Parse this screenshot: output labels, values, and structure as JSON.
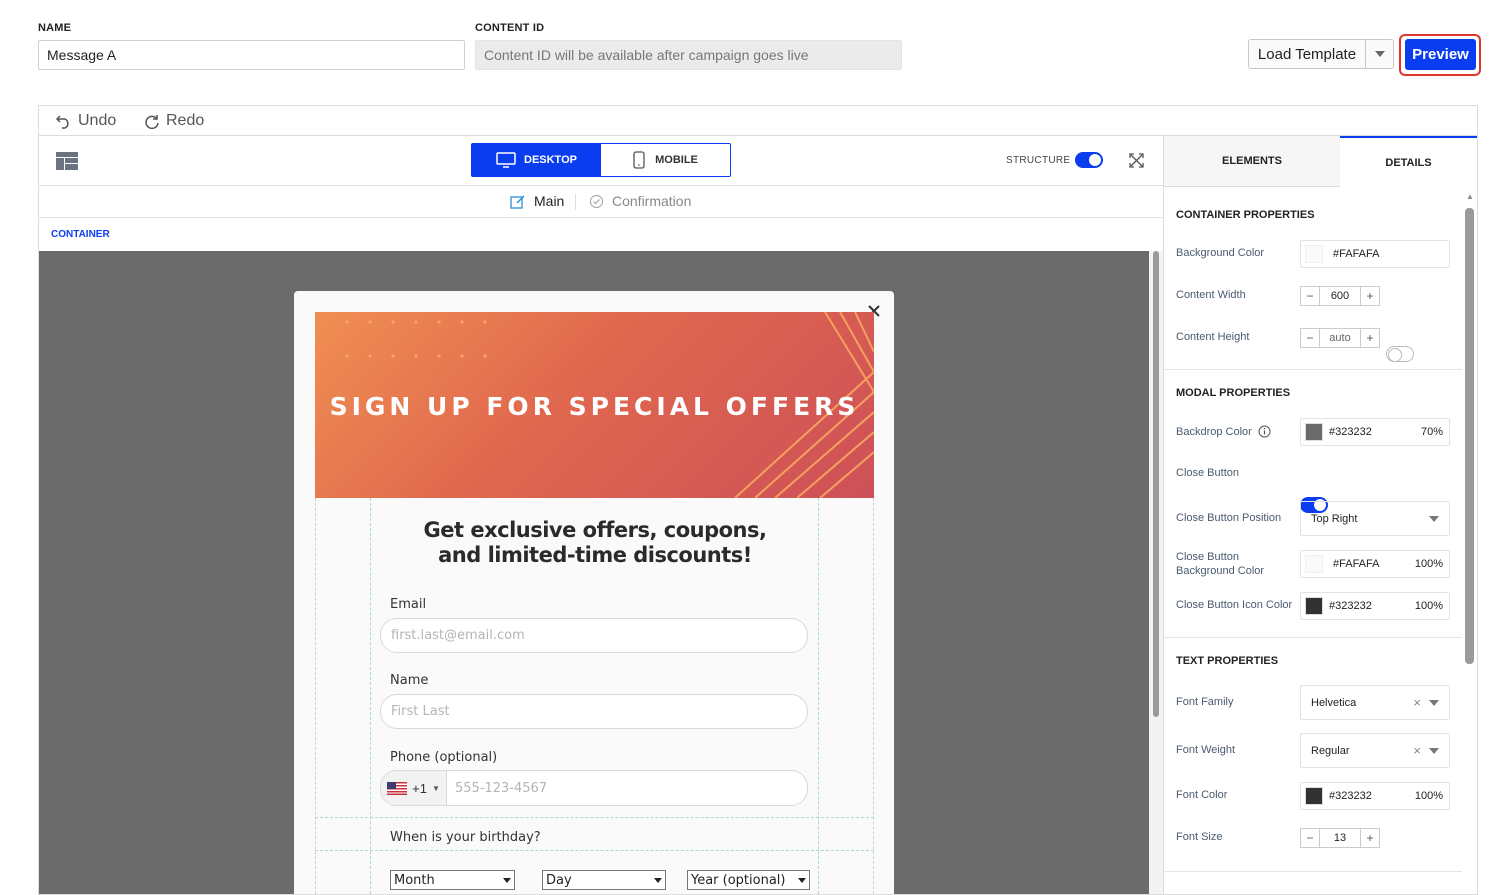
{
  "header": {
    "name_label": "NAME",
    "name_value": "Message A",
    "content_id_label": "CONTENT ID",
    "content_id_placeholder": "Content ID will be available after campaign goes live",
    "load_template": "Load Template",
    "preview": "Preview"
  },
  "editor": {
    "undo": "Undo",
    "redo": "Redo",
    "view_desktop": "DESKTOP",
    "view_mobile": "MOBILE",
    "structure_label": "STRUCTURE",
    "tab_main": "Main",
    "tab_confirmation": "Confirmation",
    "breadcrumb": "CONTAINER"
  },
  "modal": {
    "banner_text": "SIGN UP FOR SPECIAL OFFERS",
    "headline": "Get exclusive offers, coupons, and limited-time discounts!",
    "email_label": "Email",
    "email_placeholder": "first.last@email.com",
    "name_label": "Name",
    "name_placeholder": "First Last",
    "phone_label": "Phone (optional)",
    "phone_code": "+1",
    "phone_placeholder": "555-123-4567",
    "birthday_label": "When is your birthday?",
    "month": "Month",
    "day": "Day",
    "year": "Year (optional)"
  },
  "panel": {
    "tab_elements": "ELEMENTS",
    "tab_details": "DETAILS",
    "container_section": "CONTAINER PROPERTIES",
    "bg_color_label": "Background Color",
    "bg_color_value": "#FAFAFA",
    "content_width_label": "Content Width",
    "content_width_value": "600",
    "content_height_label": "Content Height",
    "content_height_value": "auto",
    "modal_section": "MODAL PROPERTIES",
    "backdrop_label": "Backdrop Color",
    "backdrop_value": "#323232",
    "backdrop_opacity": "70%",
    "close_button_label": "Close Button",
    "close_pos_label": "Close Button Position",
    "close_pos_value": "Top Right",
    "close_bg_label": "Close Button Background Color",
    "close_bg_value": "#FAFAFA",
    "close_bg_opacity": "100%",
    "close_icon_label": "Close Button Icon Color",
    "close_icon_value": "#323232",
    "close_icon_opacity": "100%",
    "text_section": "TEXT PROPERTIES",
    "font_family_label": "Font Family",
    "font_family_value": "Helvetica",
    "font_weight_label": "Font Weight",
    "font_weight_value": "Regular",
    "font_color_label": "Font Color",
    "font_color_value": "#323232",
    "font_color_opacity": "100%",
    "font_size_label": "Font Size",
    "font_size_value": "13"
  },
  "colors": {
    "accent": "#0a3cf0",
    "backdrop": "#6b6b6b",
    "preview_ring": "#e0342f"
  }
}
